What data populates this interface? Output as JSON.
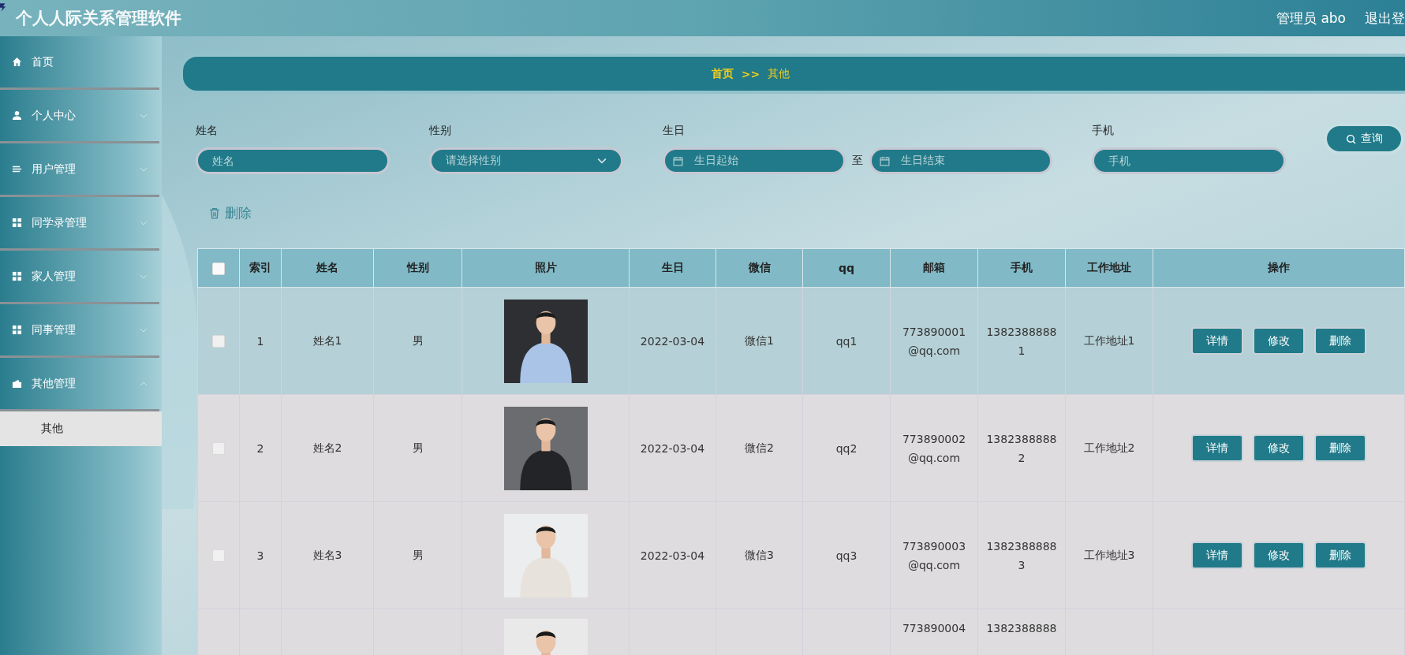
{
  "header": {
    "title": "个人人际关系管理软件",
    "user": "管理员 abo",
    "logout": "退出登"
  },
  "sidebar": {
    "items": [
      {
        "label": "首页",
        "kind": "link"
      },
      {
        "label": "个人中心",
        "kind": "menu",
        "expanded": false
      },
      {
        "label": "用户管理",
        "kind": "menu",
        "expanded": false
      },
      {
        "label": "同学录管理",
        "kind": "menu",
        "expanded": false
      },
      {
        "label": "家人管理",
        "kind": "menu",
        "expanded": false
      },
      {
        "label": "同事管理",
        "kind": "menu",
        "expanded": false
      },
      {
        "label": "其他管理",
        "kind": "menu",
        "expanded": true,
        "children": [
          {
            "label": "其他",
            "selected": true
          }
        ]
      }
    ]
  },
  "breadcrumb": {
    "home": "首页",
    "separator": ">>",
    "current": "其他"
  },
  "filters": {
    "name": {
      "label": "姓名",
      "placeholder": "姓名"
    },
    "gender": {
      "label": "性别",
      "placeholder": "请选择性别"
    },
    "birthday": {
      "label": "生日",
      "start_placeholder": "生日起始",
      "to": "至",
      "end_placeholder": "生日结束"
    },
    "phone": {
      "label": "手机",
      "placeholder": "手机"
    },
    "search_button": "查询"
  },
  "delete_button": "删除",
  "table": {
    "select_all": {
      "checked": false
    },
    "columns": [
      "索引",
      "姓名",
      "性别",
      "照片",
      "生日",
      "微信",
      "qq",
      "邮箱",
      "手机",
      "工作地址",
      "操作"
    ],
    "rows": [
      {
        "checked": false,
        "highlighted": true,
        "index": "1",
        "name": "姓名1",
        "gender": "男",
        "photo": {
          "kind": "picture"
        },
        "birthday": "2022-03-04",
        "wechat": "微信1",
        "qq": "qq1",
        "email": "773890001@qq.com",
        "phone": "13823888881",
        "address": "工作地址1",
        "actions": [
          "详情",
          "修改",
          "删除"
        ]
      },
      {
        "checked": false,
        "highlighted": false,
        "index": "2",
        "name": "姓名2",
        "gender": "男",
        "photo": {
          "kind": "picture"
        },
        "birthday": "2022-03-04",
        "wechat": "微信2",
        "qq": "qq2",
        "email": "773890002@qq.com",
        "phone": "13823888882",
        "address": "工作地址2",
        "actions": [
          "详情",
          "修改",
          "删除"
        ]
      },
      {
        "checked": false,
        "highlighted": false,
        "index": "3",
        "name": "姓名3",
        "gender": "男",
        "photo": {
          "kind": "picture"
        },
        "birthday": "2022-03-04",
        "wechat": "微信3",
        "qq": "qq3",
        "email": "773890003@qq.com",
        "phone": "13823888883",
        "address": "工作地址3",
        "actions": [
          "详情",
          "修改",
          "删除"
        ]
      },
      {
        "highlighted": false,
        "photo": {
          "kind": "picture"
        },
        "email": "773890004",
        "phone": "1382388888"
      }
    ]
  }
}
